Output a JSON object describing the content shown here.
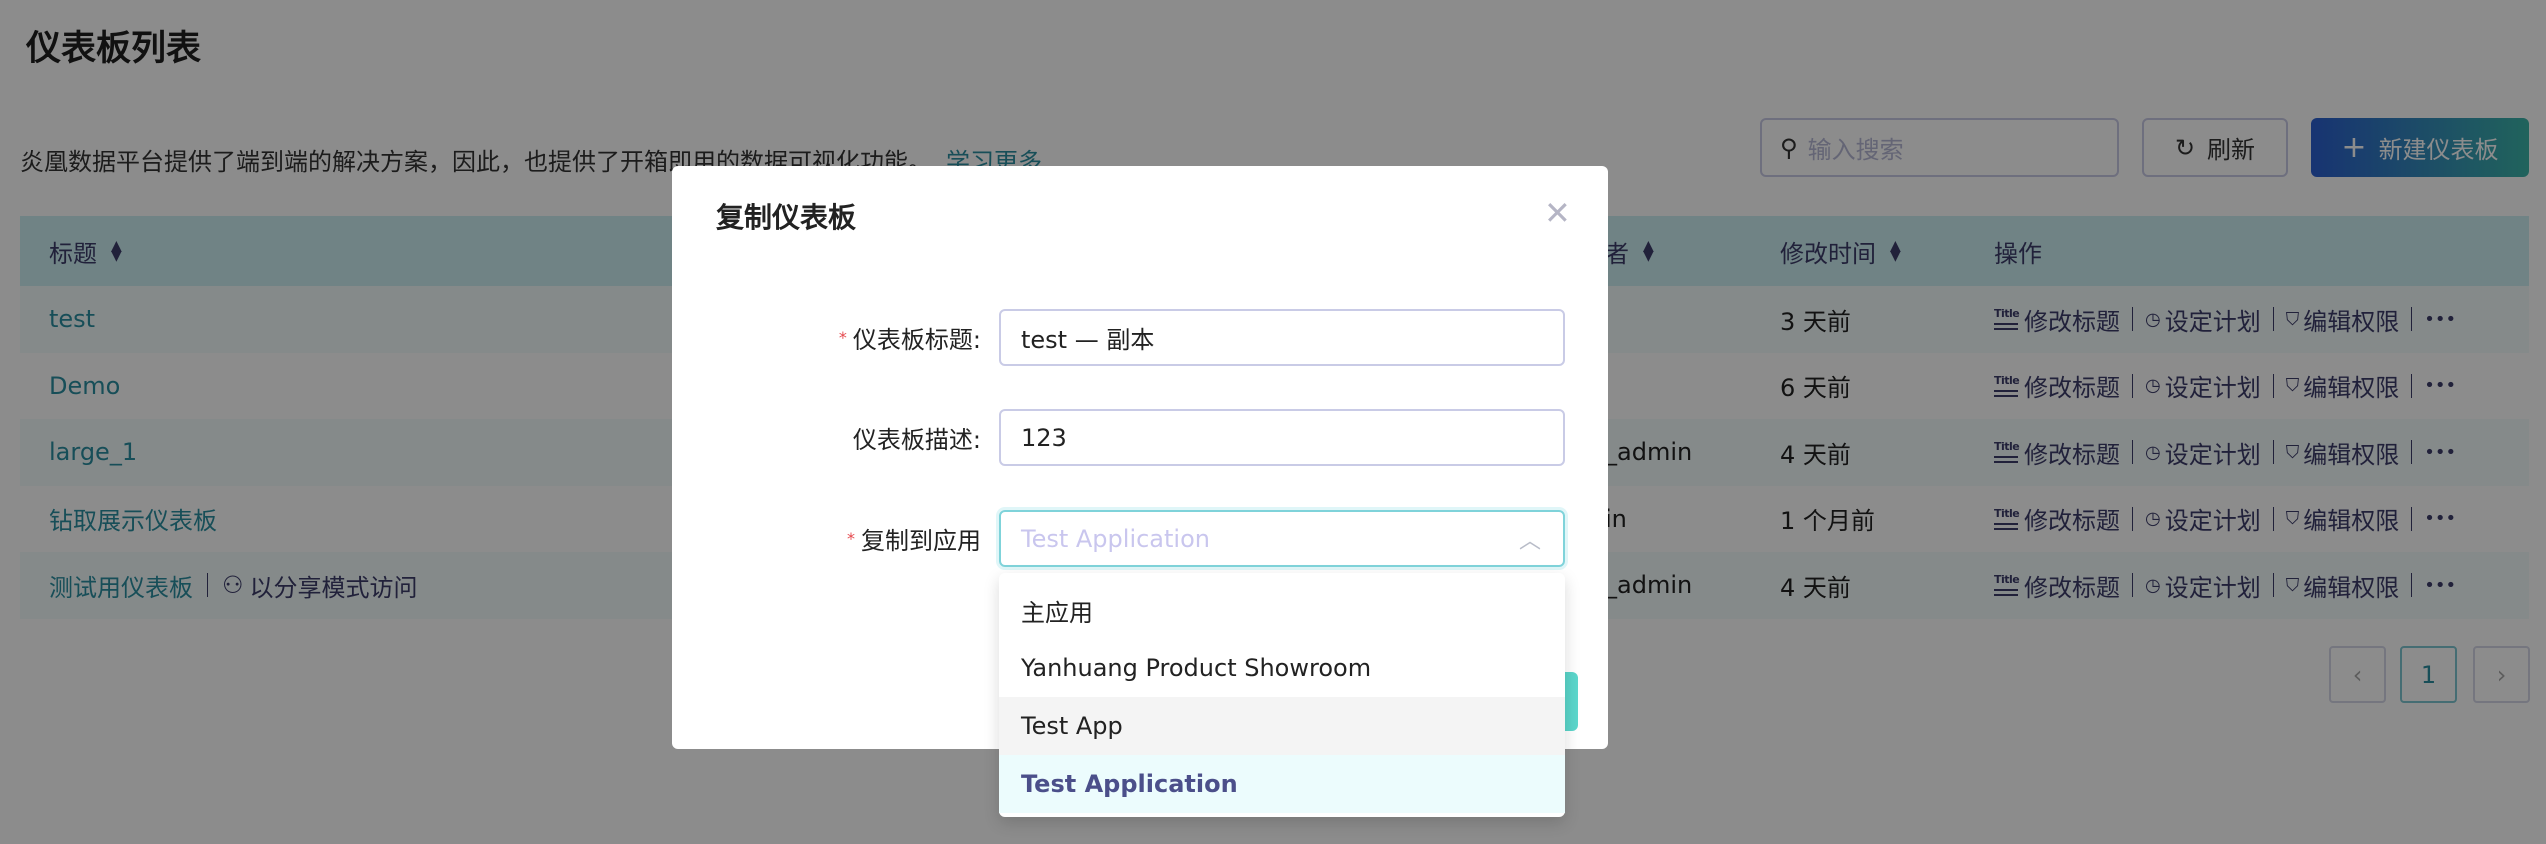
{
  "page": {
    "title": "仪表板列表",
    "description": "炎凰数据平台提供了端到端的解决方案，因此，也提供了开箱即用的数据可视化功能。",
    "learn_more": "学习更多"
  },
  "toolbar": {
    "search_placeholder": "输入搜索",
    "refresh": "刷新",
    "new_dashboard": "新建仪表板"
  },
  "table": {
    "headers": {
      "title": "标题",
      "author": "者",
      "modified": "修改时间",
      "actions": "操作"
    },
    "actions": {
      "edit_title": "修改标题",
      "schedule": "设定计划",
      "permissions": "编辑权限",
      "more": "•••",
      "title_icon_text": "Title"
    },
    "rows": [
      {
        "title": "test",
        "author": "",
        "modified": "3 天前"
      },
      {
        "title": "Demo",
        "author": "",
        "modified": "6 天前"
      },
      {
        "title": "large_1",
        "author": "_admin",
        "modified": "4 天前"
      },
      {
        "title": "钻取展示仪表板",
        "author": "in",
        "modified": "1 个月前"
      },
      {
        "title": "测试用仪表板",
        "share": "以分享模式访问",
        "author": "_admin",
        "modified": "4 天前"
      }
    ]
  },
  "pagination": {
    "prev": "‹",
    "current": "1",
    "next": "›"
  },
  "modal": {
    "title": "复制仪表板",
    "close": "✕",
    "fields": {
      "title_label": "仪表板标题:",
      "title_value": "test — 副本",
      "desc_label": "仪表板描述:",
      "desc_value": "123",
      "app_label": "复制到应用",
      "app_value": "Test Application"
    },
    "required_mark": "*",
    "options": [
      "主应用",
      "Yanhuang Product Showroom",
      "Test App",
      "Test Application"
    ]
  },
  "colors": {
    "accent": "#2b8fa0",
    "header_bg": "#cdeef2",
    "primary_start": "#2c5fd0",
    "primary_end": "#3cb5a8"
  }
}
